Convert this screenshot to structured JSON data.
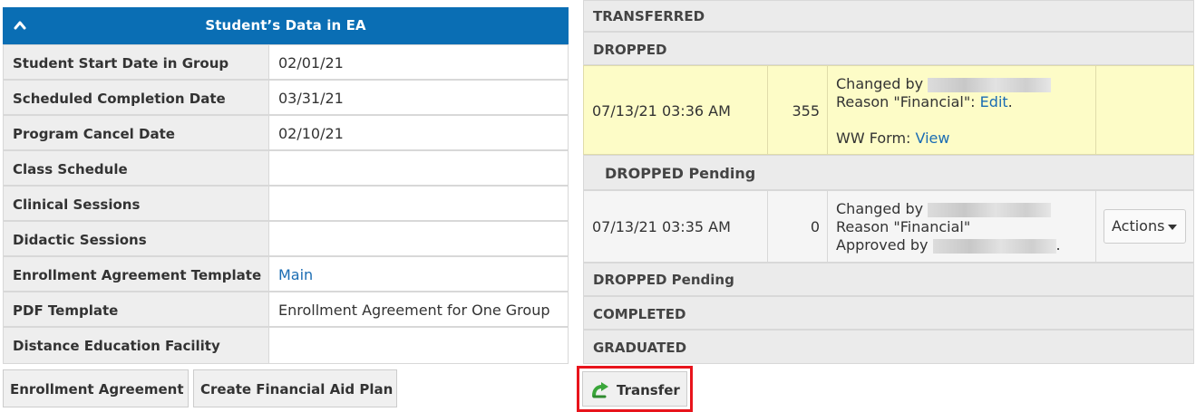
{
  "student_data": {
    "title": "Student’s Data in EA",
    "rows": [
      {
        "label": "Student Start Date in Group",
        "value": "02/01/21"
      },
      {
        "label": "Scheduled Completion Date",
        "value": "03/31/21"
      },
      {
        "label": "Program Cancel Date",
        "value": "02/10/21"
      },
      {
        "label": "Class Schedule",
        "value": ""
      },
      {
        "label": "Clinical Sessions",
        "value": ""
      },
      {
        "label": "Didactic Sessions",
        "value": ""
      },
      {
        "label": "Enrollment Agreement Template",
        "value": "Main"
      },
      {
        "label": "PDF Template",
        "value": "Enrollment Agreement for One Group"
      },
      {
        "label": "Distance Education Facility",
        "value": ""
      }
    ]
  },
  "buttons": {
    "enrollment_agreement": "Enrollment Agreement",
    "create_financial_aid_plan": "Create Financial Aid Plan",
    "transfer": "Transfer"
  },
  "statuses": {
    "transferred": "TRANSFERRED",
    "dropped": "DROPPED",
    "dropped_entry": {
      "datetime": "07/13/21 03:36 AM",
      "count": "355",
      "changed_by_label": "Changed by",
      "reason_label": "Reason \"Financial\":",
      "edit_link": "Edit",
      "ww_form_label": "WW Form:",
      "view_link": "View"
    },
    "dropped_pending_heading": "DROPPED Pending",
    "pending_entry": {
      "datetime": "07/13/21 03:35 AM",
      "count": "0",
      "changed_by_label": "Changed by",
      "reason_label": "Reason \"Financial\"",
      "approved_by_label": "Approved by",
      "actions_label": "Actions"
    },
    "dropped_pending": "DROPPED Pending",
    "completed": "COMPLETED",
    "graduated": "GRADUATED"
  },
  "colors": {
    "header_blue": "#0a6eb4",
    "link_blue": "#1a6cb3",
    "highlight_yellow": "#fdfcc7",
    "highlight_frame_red": "#e8141c"
  },
  "icons": {
    "collapse": "chevron-up-icon",
    "transfer": "transfer-arrow-icon",
    "actions_dropdown": "caret-down-icon"
  }
}
